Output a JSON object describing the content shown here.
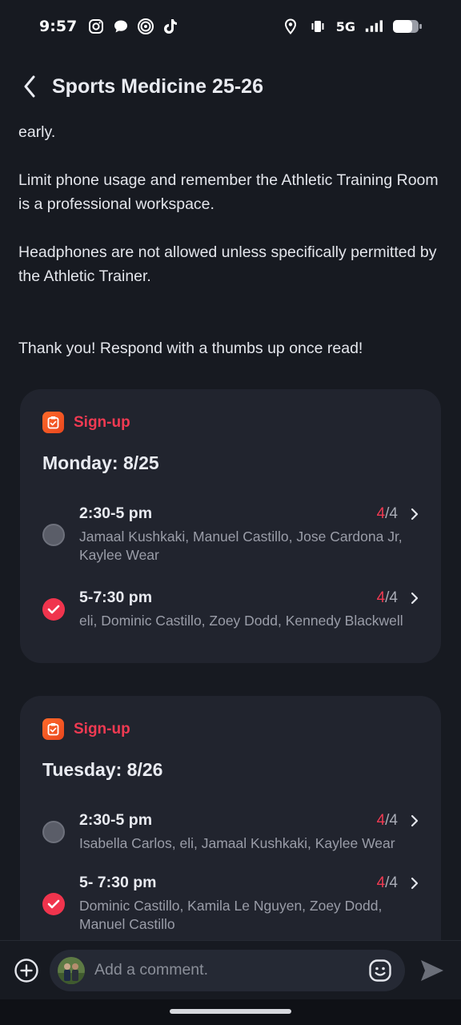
{
  "status_bar": {
    "time": "9:57",
    "network": "5G",
    "left_icons": [
      "instagram-icon",
      "chat-icon",
      "threads-icon",
      "tiktok-icon"
    ],
    "right_icons": [
      "location-icon",
      "vibrate-icon",
      "signal-icon",
      "battery-icon"
    ]
  },
  "header": {
    "title": "Sports Medicine 25-26",
    "back_icon": "back-arrow-icon"
  },
  "post": {
    "partial_line": "early.",
    "paragraph_phone": "Limit phone usage and remember the Athletic Training Room is a professional workspace.",
    "paragraph_headphones": "Headphones are not allowed unless specifically permitted by the Athletic Trainer.",
    "paragraph_thanks": "Thank you! Respond with a thumbs up once read!"
  },
  "signups": [
    {
      "tag": "Sign-up",
      "date": "Monday: 8/25",
      "slots": [
        {
          "time": "2:30-5 pm",
          "filled": "4",
          "total": "/4",
          "names": "Jamaal Kushkaki, Manuel Castillo, Jose Cardona Jr, Kaylee Wear",
          "checked": false
        },
        {
          "time": "5-7:30 pm",
          "filled": "4",
          "total": "/4",
          "names": "eli, Dominic Castillo, Zoey Dodd, Kennedy Blackwell",
          "checked": true
        }
      ]
    },
    {
      "tag": "Sign-up",
      "date": "Tuesday: 8/26",
      "slots": [
        {
          "time": "2:30-5 pm",
          "filled": "4",
          "total": "/4",
          "names": "Isabella Carlos, eli, Jamaal Kushkaki, Kaylee Wear",
          "checked": false
        },
        {
          "time": "5- 7:30 pm",
          "filled": "4",
          "total": "/4",
          "names": "Dominic Castillo, Kamila Le Nguyen, Zoey Dodd, Manuel Castillo",
          "checked": true
        }
      ]
    }
  ],
  "comment_bar": {
    "placeholder": "Add a comment.",
    "icons": [
      "add-icon",
      "avatar",
      "emoji-icon",
      "send-icon"
    ]
  },
  "colors": {
    "background": "#171a21",
    "card": "#21242e",
    "accent": "#f03a52",
    "tag_orange": "#ff6a2a"
  }
}
